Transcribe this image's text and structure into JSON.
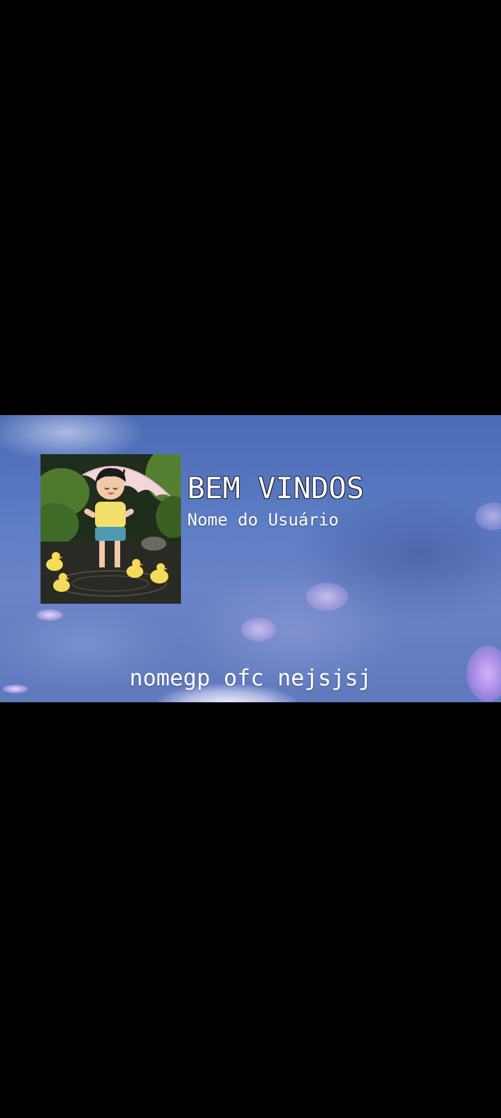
{
  "banner": {
    "title": "BEM VINDOS",
    "username": "Nome do Usuário",
    "group_name": "nomegp ofc nejsjsj"
  },
  "avatar": {
    "icon": "profile-picture-child-umbrella-ducks"
  },
  "colors": {
    "background": "#000000",
    "banner_sky": "#5b7cc4",
    "text": "#ffffff"
  }
}
